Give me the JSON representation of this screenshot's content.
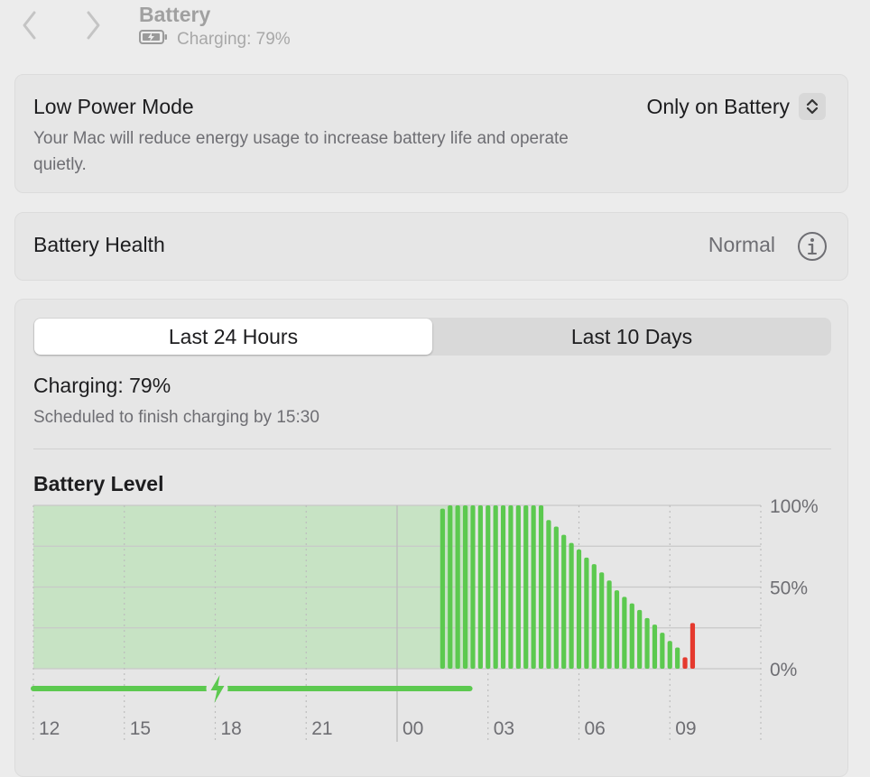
{
  "window": {
    "title": "Battery",
    "subtitle": "Charging: 79%",
    "back_icon": "chevron-left-icon",
    "forward_icon": "chevron-right-icon",
    "battery_icon": "battery-charging-icon"
  },
  "low_power_mode": {
    "title": "Low Power Mode",
    "description": "Your Mac will reduce energy usage to increase battery life and operate quietly.",
    "value": "Only on Battery"
  },
  "battery_health": {
    "title": "Battery Health",
    "value": "Normal",
    "info_icon": "info-icon"
  },
  "usage": {
    "tabs": [
      {
        "label": "Last 24 Hours",
        "selected": true
      },
      {
        "label": "Last 10 Days",
        "selected": false
      }
    ],
    "status_title": "Charging: 79%",
    "status_sub": "Scheduled to finish charging by 15:30",
    "chart_title": "Battery Level"
  },
  "colors": {
    "green": "#5cc94f",
    "green_area": "#c7e3c4",
    "red": "#e5392e"
  },
  "chart_data": {
    "type": "bar",
    "title": "Battery Level",
    "y_ticks": [
      "0%",
      "50%",
      "100%"
    ],
    "ylim": [
      0,
      100
    ],
    "x_ticks": [
      "12",
      "15",
      "18",
      "21",
      "00",
      "03",
      "06",
      "09"
    ],
    "charging_area": {
      "from_hour": 0,
      "to_hour": 14.4,
      "level": 100
    },
    "charging_line": {
      "from_hour": 0,
      "to_hour": 14.4
    },
    "series": [
      {
        "values": [
          {
            "hour": 13.5,
            "level": 98,
            "color": "green"
          },
          {
            "hour": 13.75,
            "level": 100,
            "color": "green"
          },
          {
            "hour": 14.0,
            "level": 100,
            "color": "green"
          },
          {
            "hour": 14.25,
            "level": 100,
            "color": "green"
          },
          {
            "hour": 14.5,
            "level": 100,
            "color": "green"
          },
          {
            "hour": 14.75,
            "level": 100,
            "color": "green"
          },
          {
            "hour": 15.0,
            "level": 100,
            "color": "green"
          },
          {
            "hour": 15.25,
            "level": 100,
            "color": "green"
          },
          {
            "hour": 15.5,
            "level": 100,
            "color": "green"
          },
          {
            "hour": 15.75,
            "level": 100,
            "color": "green"
          },
          {
            "hour": 16.0,
            "level": 100,
            "color": "green"
          },
          {
            "hour": 16.25,
            "level": 100,
            "color": "green"
          },
          {
            "hour": 16.5,
            "level": 100,
            "color": "green"
          },
          {
            "hour": 16.75,
            "level": 100,
            "color": "green"
          },
          {
            "hour": 17.0,
            "level": 91,
            "color": "green"
          },
          {
            "hour": 17.25,
            "level": 87,
            "color": "green"
          },
          {
            "hour": 17.5,
            "level": 82,
            "color": "green"
          },
          {
            "hour": 17.75,
            "level": 77,
            "color": "green"
          },
          {
            "hour": 18.0,
            "level": 73,
            "color": "green"
          },
          {
            "hour": 18.25,
            "level": 68,
            "color": "green"
          },
          {
            "hour": 18.5,
            "level": 64,
            "color": "green"
          },
          {
            "hour": 18.75,
            "level": 59,
            "color": "green"
          },
          {
            "hour": 19.0,
            "level": 54,
            "color": "green"
          },
          {
            "hour": 19.25,
            "level": 48,
            "color": "green"
          },
          {
            "hour": 19.5,
            "level": 44,
            "color": "green"
          },
          {
            "hour": 19.75,
            "level": 40,
            "color": "green"
          },
          {
            "hour": 20.0,
            "level": 36,
            "color": "green"
          },
          {
            "hour": 20.25,
            "level": 31,
            "color": "green"
          },
          {
            "hour": 20.5,
            "level": 27,
            "color": "green"
          },
          {
            "hour": 20.75,
            "level": 22,
            "color": "green"
          },
          {
            "hour": 21.0,
            "level": 17,
            "color": "green"
          },
          {
            "hour": 21.25,
            "level": 13,
            "color": "green"
          },
          {
            "hour": 21.5,
            "level": 7,
            "color": "red"
          },
          {
            "hour": 21.75,
            "level": 28,
            "color": "red"
          }
        ]
      }
    ]
  }
}
